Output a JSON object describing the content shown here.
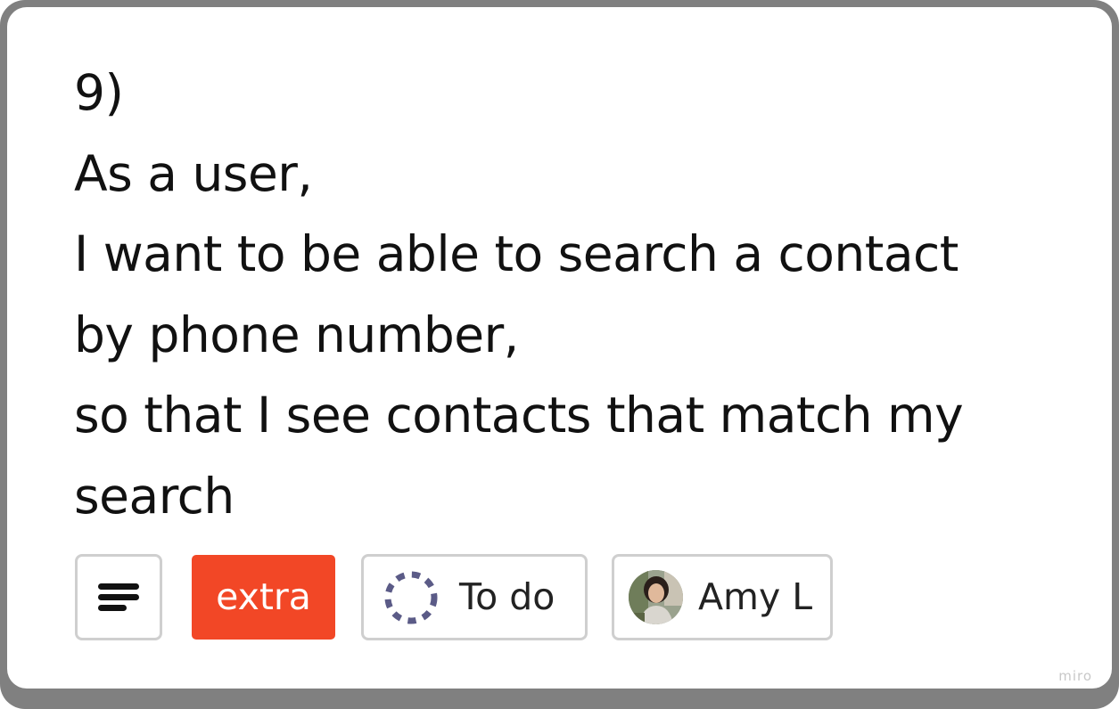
{
  "card": {
    "lines": [
      "9)",
      "As a user,",
      "I want to be able to search a contact",
      "by phone number,",
      "so that I see contacts that match my",
      "search"
    ]
  },
  "chips": {
    "description_icon": "description-lines-icon",
    "tag": {
      "label": "extra",
      "color": "#f24726"
    },
    "status": {
      "label": "To do",
      "icon": "dashed-circle-icon",
      "color": "#5b5b87"
    },
    "assignee": {
      "name": "Amy L",
      "icon": "avatar-photo"
    }
  },
  "watermark": "miro"
}
